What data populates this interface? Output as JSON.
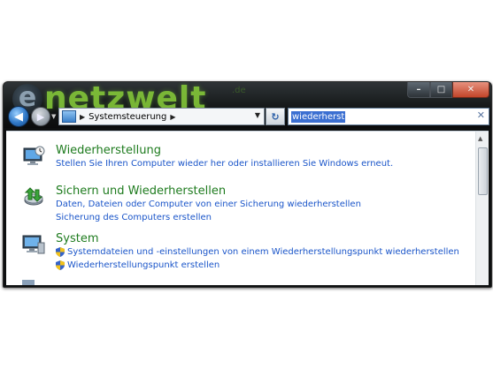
{
  "window": {
    "logo_letter": "e",
    "logo_text": "netzwelt",
    "logo_suffix": ".de"
  },
  "caption_buttons": {
    "minimize": "–",
    "maximize": "□",
    "close": "✕"
  },
  "navigation": {
    "back_glyph": "◀",
    "forward_glyph": "▶",
    "dropdown_glyph": "▼"
  },
  "address_bar": {
    "separator": "▶",
    "breadcrumb": "Systemsteuerung",
    "dropdown_glyph": "▼"
  },
  "refresh_glyph": "↻",
  "search": {
    "value": "wiederherst",
    "clear_glyph": "✕"
  },
  "results": [
    {
      "title": "Wiederherstellung",
      "links": [
        {
          "text": "Stellen Sie Ihren Computer wieder her oder installieren Sie Windows erneut.",
          "shield": false
        }
      ]
    },
    {
      "title": "Sichern und Wiederherstellen",
      "links": [
        {
          "text": "Daten, Dateien oder Computer von einer Sicherung wiederherstellen",
          "shield": false
        },
        {
          "text": "Sicherung des Computers erstellen",
          "shield": false
        }
      ]
    },
    {
      "title": "System",
      "links": [
        {
          "text": "Systemdateien und -einstellungen von einem Wiederherstellungspunkt wiederherstellen",
          "shield": true
        },
        {
          "text": "Wiederherstellungspunkt erstellen",
          "shield": true
        }
      ]
    }
  ],
  "scrollbar": {
    "up_glyph": "▲"
  },
  "colors": {
    "title_green": "#1e7b1e",
    "link_blue": "#1a55c9",
    "logo_green": "#8ad23a"
  }
}
